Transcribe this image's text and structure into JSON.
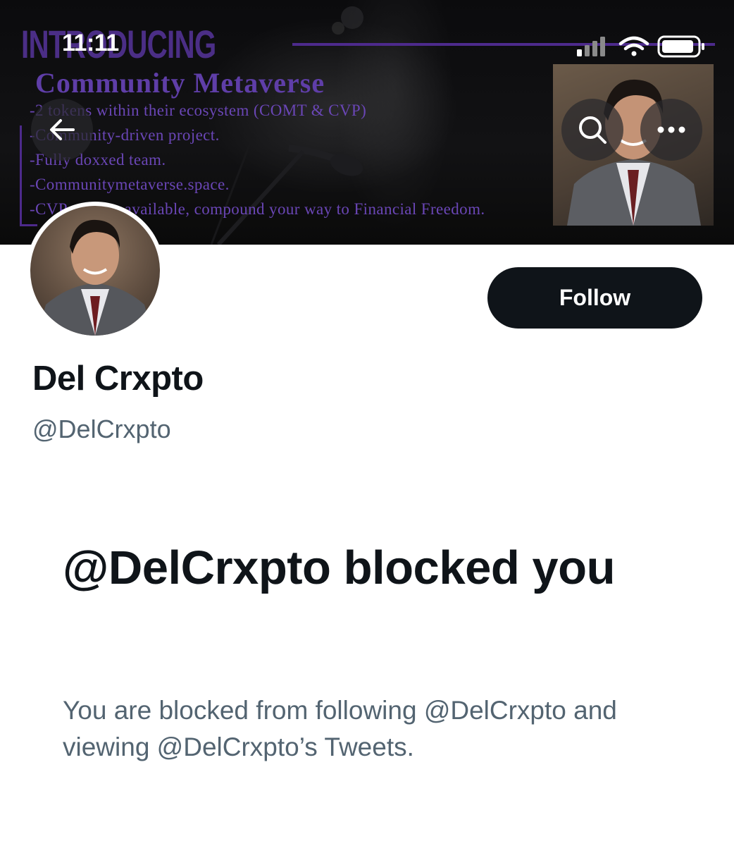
{
  "status_bar": {
    "time": "11:11"
  },
  "banner": {
    "heading": "INTRODUCING",
    "subtitle": "Community Metaverse",
    "bullets": [
      "-2 tokens within their ecosystem (COMT & CVP)",
      "-Community-driven project.",
      "-Fully doxxed team.",
      "-Communitymetaverse.space.",
      "-CVP staking available, compound your way to Financial Freedom."
    ]
  },
  "header_buttons": {
    "back_icon": "arrow-left-icon",
    "search_icon": "search-icon",
    "more_icon": "more-horizontal-icon"
  },
  "profile": {
    "display_name": "Del Crxpto",
    "handle": "@DelCrxpto",
    "follow_label": "Follow"
  },
  "blocked_notice": {
    "title": "@DelCrxpto blocked you",
    "description": "You are blocked from following @DelCrxpto and viewing @DelCrxpto’s Tweets."
  },
  "colors": {
    "primary_text": "#0f1419",
    "secondary_text": "#536471",
    "follow_button": "#0f1419",
    "banner_purple": "#5f3ea8"
  }
}
